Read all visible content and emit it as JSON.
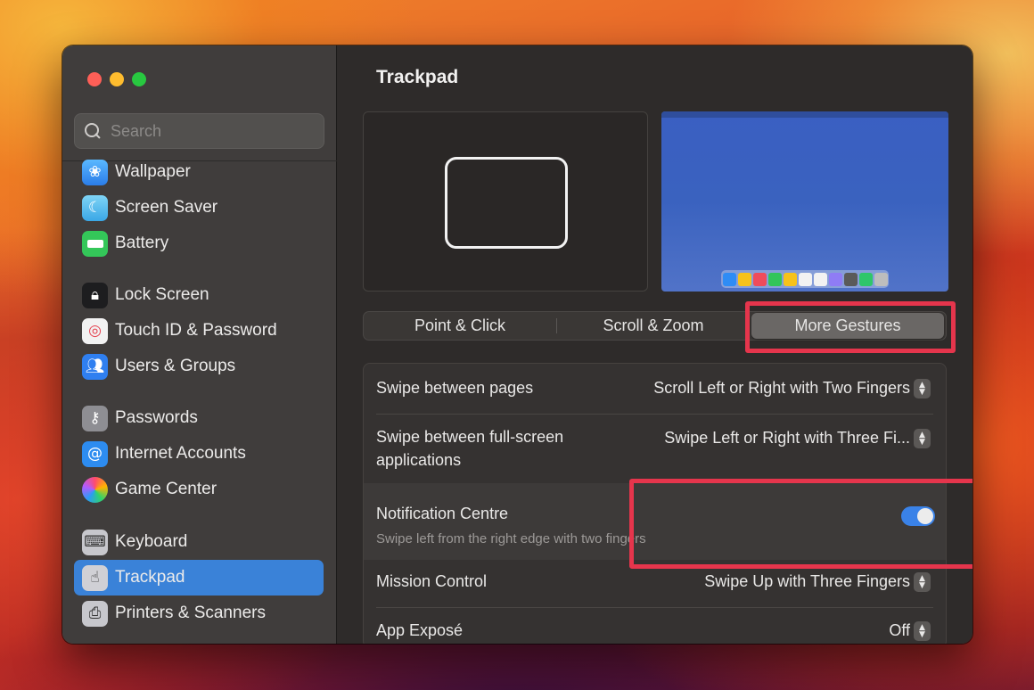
{
  "window": {
    "title": "Trackpad"
  },
  "sidebar": {
    "search_placeholder": "Search",
    "items": [
      {
        "label": "Wallpaper",
        "icon": "wallpaper-icon"
      },
      {
        "label": "Screen Saver",
        "icon": "screen-saver-icon"
      },
      {
        "label": "Battery",
        "icon": "battery-icon"
      },
      {
        "label": "Lock Screen",
        "icon": "lock-icon"
      },
      {
        "label": "Touch ID & Password",
        "icon": "fingerprint-icon"
      },
      {
        "label": "Users & Groups",
        "icon": "users-icon"
      },
      {
        "label": "Passwords",
        "icon": "key-icon"
      },
      {
        "label": "Internet Accounts",
        "icon": "at-icon"
      },
      {
        "label": "Game Center",
        "icon": "game-center-icon"
      },
      {
        "label": "Keyboard",
        "icon": "keyboard-icon"
      },
      {
        "label": "Trackpad",
        "icon": "trackpad-icon",
        "selected": true
      },
      {
        "label": "Printers & Scanners",
        "icon": "printer-icon"
      }
    ]
  },
  "tabs": {
    "items": [
      "Point & Click",
      "Scroll & Zoom",
      "More Gestures"
    ],
    "selected": "More Gestures"
  },
  "settings": [
    {
      "label": "Swipe between pages",
      "value": "Scroll Left or Right with Two Fingers"
    },
    {
      "label": "Swipe between full-screen applications",
      "value": "Swipe Left or Right with Three Fi..."
    },
    {
      "label": "Notification Centre",
      "sublabel": "Swipe left from the right edge with two fingers",
      "toggle": true
    },
    {
      "label": "Mission Control",
      "value": "Swipe Up with Three Fingers"
    },
    {
      "label": "App Exposé",
      "value": "Off"
    }
  ],
  "colors": {
    "accent": "#3a82d8",
    "highlight": "#e5354c",
    "dock_icons": [
      "#2f8cf5",
      "#f6c21b",
      "#ef4c5b",
      "#32c55a",
      "#f6c21b",
      "#f2f2f2",
      "#f2f2f2",
      "#8f7cf5",
      "#5a5a5a",
      "#2fc66a",
      "#bdbdbd"
    ]
  }
}
